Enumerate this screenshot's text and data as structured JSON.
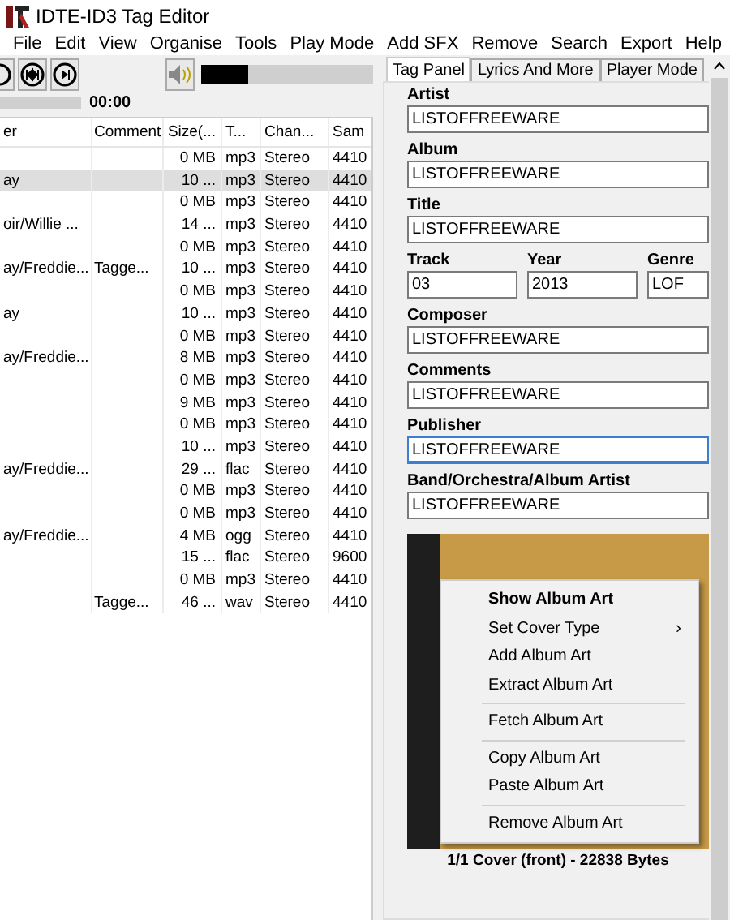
{
  "window": {
    "title": "IDTE-ID3 Tag Editor"
  },
  "menu": [
    "File",
    "Edit",
    "View",
    "Organise",
    "Tools",
    "Play Mode",
    "Add SFX",
    "Remove",
    "Search",
    "Export",
    "Help"
  ],
  "player": {
    "volume": {
      "level": 0.27
    },
    "time": "00:00"
  },
  "table": {
    "columns": [
      "er",
      "Comment",
      "Size(...",
      "T...",
      "Chan...",
      "Sam"
    ],
    "rows": [
      {
        "cells": [
          "",
          "",
          "0 MB",
          "mp3",
          "Stereo",
          "4410"
        ],
        "selected": false
      },
      {
        "cells": [
          "ay",
          "",
          "10 ...",
          "mp3",
          "Stereo",
          "4410"
        ],
        "selected": true
      },
      {
        "cells": [
          "",
          "",
          "0 MB",
          "mp3",
          "Stereo",
          "4410"
        ],
        "selected": false
      },
      {
        "cells": [
          "oir/Willie ...",
          "",
          "14 ...",
          "mp3",
          "Stereo",
          "4410"
        ],
        "selected": false
      },
      {
        "cells": [
          "",
          "",
          "0 MB",
          "mp3",
          "Stereo",
          "4410"
        ],
        "selected": false
      },
      {
        "cells": [
          "ay/Freddie...",
          "Tagge...",
          "10 ...",
          "mp3",
          "Stereo",
          "4410"
        ],
        "selected": false
      },
      {
        "cells": [
          "",
          "",
          "0 MB",
          "mp3",
          "Stereo",
          "4410"
        ],
        "selected": false
      },
      {
        "cells": [
          "ay",
          "",
          "10 ...",
          "mp3",
          "Stereo",
          "4410"
        ],
        "selected": false
      },
      {
        "cells": [
          "",
          "",
          "0 MB",
          "mp3",
          "Stereo",
          "4410"
        ],
        "selected": false
      },
      {
        "cells": [
          "ay/Freddie...",
          "",
          "8 MB",
          "mp3",
          "Stereo",
          "4410"
        ],
        "selected": false
      },
      {
        "cells": [
          "",
          "",
          "0 MB",
          "mp3",
          "Stereo",
          "4410"
        ],
        "selected": false
      },
      {
        "cells": [
          "",
          "",
          "9 MB",
          "mp3",
          "Stereo",
          "4410"
        ],
        "selected": false
      },
      {
        "cells": [
          "",
          "",
          "0 MB",
          "mp3",
          "Stereo",
          "4410"
        ],
        "selected": false
      },
      {
        "cells": [
          "",
          "",
          "10 ...",
          "mp3",
          "Stereo",
          "4410"
        ],
        "selected": false
      },
      {
        "cells": [
          "ay/Freddie...",
          "",
          "29 ...",
          "flac",
          "Stereo",
          "4410"
        ],
        "selected": false
      },
      {
        "cells": [
          "",
          "",
          "0 MB",
          "mp3",
          "Stereo",
          "4410"
        ],
        "selected": false
      },
      {
        "cells": [
          "",
          "",
          "0 MB",
          "mp3",
          "Stereo",
          "4410"
        ],
        "selected": false
      },
      {
        "cells": [
          "ay/Freddie...",
          "",
          "4 MB",
          "ogg",
          "Stereo",
          "4410"
        ],
        "selected": false
      },
      {
        "cells": [
          "",
          "",
          "15 ...",
          "flac",
          "Stereo",
          "9600"
        ],
        "selected": false
      },
      {
        "cells": [
          "",
          "",
          "0 MB",
          "mp3",
          "Stereo",
          "4410"
        ],
        "selected": false
      },
      {
        "cells": [
          "",
          "Tagge...",
          "46 ...",
          "wav",
          "Stereo",
          "4410"
        ],
        "selected": false
      }
    ]
  },
  "tabs": [
    {
      "label": "Tag Panel",
      "selected": true
    },
    {
      "label": "Lyrics And More",
      "selected": false
    },
    {
      "label": "Player Mode",
      "selected": false
    }
  ],
  "fields": [
    {
      "label": "Artist",
      "value": "LISTOFFREEWARE",
      "focused": false
    },
    {
      "label": "Album",
      "value": "LISTOFFREEWARE",
      "focused": false
    },
    {
      "label": "Title",
      "value": "LISTOFFREEWARE",
      "focused": false
    },
    {
      "kind": "row",
      "items": [
        {
          "label": "Track",
          "value": "03"
        },
        {
          "label": "Year",
          "value": "2013"
        },
        {
          "label": "Genre",
          "value": "LOF"
        }
      ]
    },
    {
      "label": "Composer",
      "value": "LISTOFFREEWARE",
      "focused": false
    },
    {
      "label": "Comments",
      "value": "LISTOFFREEWARE",
      "focused": false
    },
    {
      "label": "Publisher",
      "value": "LISTOFFREEWARE",
      "focused": true
    },
    {
      "label": "Band/Orchestra/Album Artist",
      "value": "LISTOFFREEWARE",
      "focused": false
    }
  ],
  "context_menu": [
    {
      "kind": "item",
      "label": "Show Album Art",
      "bold": true
    },
    {
      "kind": "submenu",
      "label": "Set Cover Type",
      "arrow": "›"
    },
    {
      "kind": "item",
      "label": "Add Album Art",
      "bold": false
    },
    {
      "kind": "item",
      "label": "Extract Album Art",
      "bold": false
    },
    {
      "kind": "separator"
    },
    {
      "kind": "item",
      "label": "Fetch Album Art",
      "bold": false
    },
    {
      "kind": "separator"
    },
    {
      "kind": "item",
      "label": "Copy  Album Art",
      "bold": false
    },
    {
      "kind": "item",
      "label": "Paste Album Art",
      "bold": false
    },
    {
      "kind": "separator"
    },
    {
      "kind": "item",
      "label": "Remove Album Art",
      "bold": false
    }
  ],
  "cover_caption": "1/1 Cover (front) - 22838 Bytes"
}
